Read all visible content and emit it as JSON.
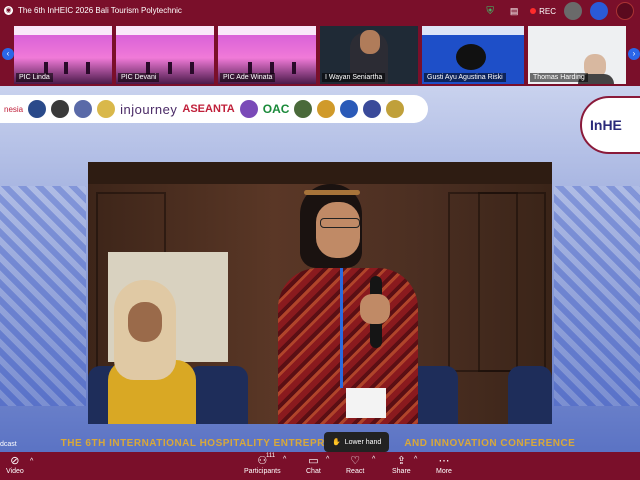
{
  "window": {
    "title": "The 6th InHEIC 2026 Bali Tourism Polytechnic",
    "rec_label": "REC"
  },
  "participants_strip": [
    {
      "name": "PIC Linda",
      "kind": "pink"
    },
    {
      "name": "PIC Devani",
      "kind": "pink"
    },
    {
      "name": "PIC Ade Winata",
      "kind": "pink"
    },
    {
      "name": "I Wayan Seniartha",
      "kind": "person"
    },
    {
      "name": "Gusti Ayu Agustina Riski",
      "kind": "blue"
    },
    {
      "name": "Thomas Harding",
      "kind": "person-light"
    }
  ],
  "stage": {
    "sponsor_texts": [
      "injourney",
      "ASEANTA",
      "OAC"
    ],
    "badge_text": "InHE",
    "left_edge_text": "nesia",
    "conference_title": "THE 6TH INTERNATIONAL HOSPITALITY ENTREPRI",
    "conference_title_end": "AND INNOVATION CONFERENCE",
    "podcast_text": "dcast"
  },
  "overlay": {
    "lower_hand_label": "Lower hand"
  },
  "toolbar": {
    "video_label": "Video",
    "participants_label": "Participants",
    "participants_count": "111",
    "chat_label": "Chat",
    "react_label": "React",
    "share_label": "Share",
    "more_label": "More"
  },
  "colors": {
    "chrome": "#7a0f2a",
    "accent": "#2b66e8",
    "rec": "#ff2b2b",
    "conference_title": "#d8a83a"
  }
}
